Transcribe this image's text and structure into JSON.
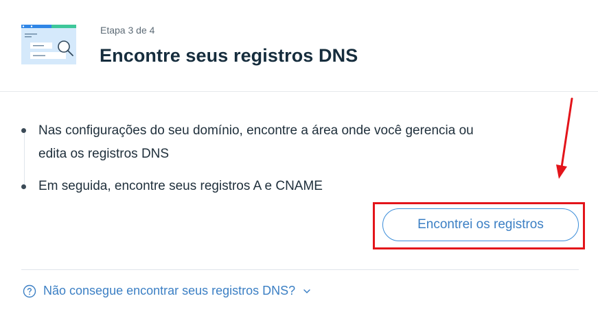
{
  "header": {
    "step": "Etapa 3 de 4",
    "title": "Encontre seus registros DNS",
    "illustration_icon": "dns-records-search-illustration"
  },
  "instructions": [
    {
      "lines": [
        "Nas configurações do seu domínio, encontre a área onde você gerencia ou",
        "edita os registros DNS"
      ]
    },
    {
      "lines": [
        "Em seguida, encontre seus registros A e CNAME"
      ]
    }
  ],
  "primary_button": {
    "label": "Encontrei os registros"
  },
  "help_link": {
    "label": "Não consegue encontrar seus registros DNS?",
    "icon": "question-circle-icon",
    "chevron": "chevron-down-icon"
  },
  "annotation": {
    "highlight_color": "#e3141a",
    "arrow_color": "#e3141a"
  },
  "colors": {
    "accent": "#3b7fc4",
    "text": "#20303c"
  }
}
